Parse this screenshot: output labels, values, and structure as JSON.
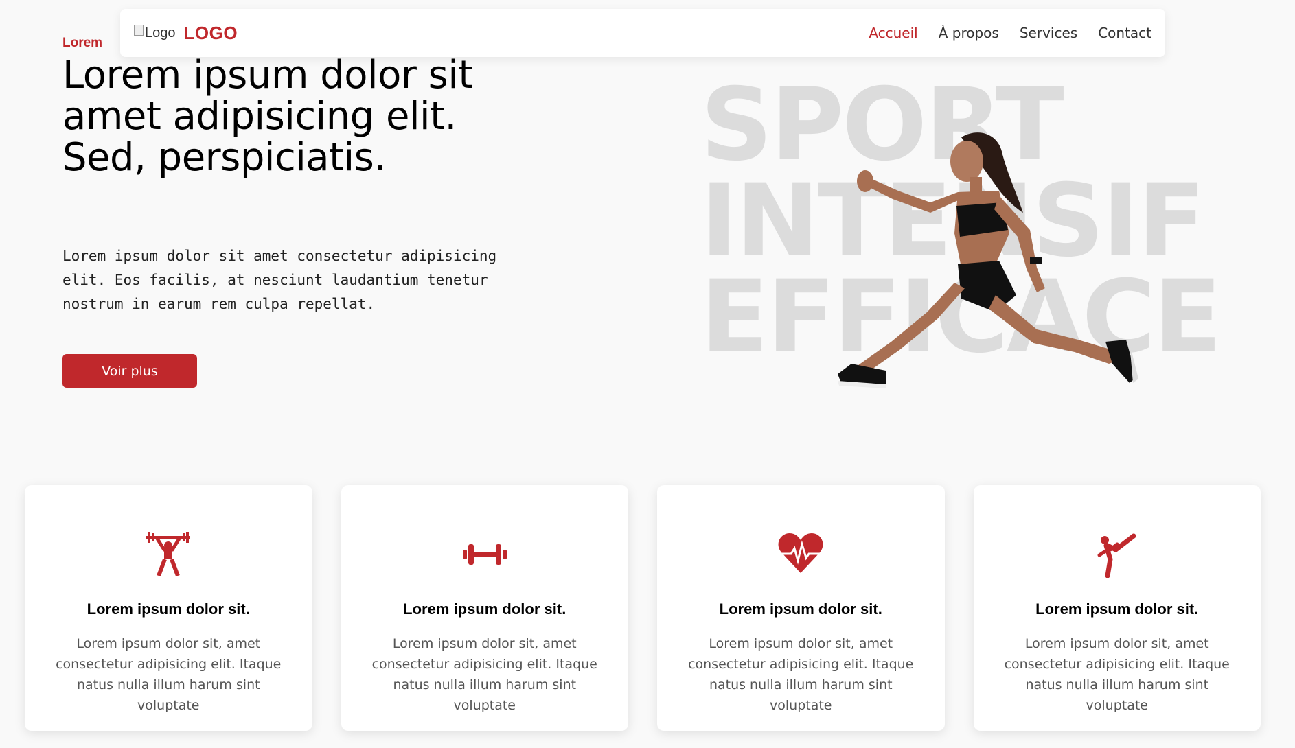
{
  "nav": {
    "logo_alt": "Logo",
    "brand": "LOGO",
    "links": [
      {
        "label": "Accueil",
        "active": true
      },
      {
        "label": "À propos",
        "active": false
      },
      {
        "label": "Services",
        "active": false
      },
      {
        "label": "Contact",
        "active": false
      }
    ]
  },
  "hero": {
    "eyebrow": "Lorem",
    "title": "Lorem ipsum dolor sit amet adipisicing elit. Sed, perspiciatis.",
    "description": "Lorem ipsum dolor sit amet consectetur adipisicing elit. Eos facilis, at nesciunt laudantium tenetur nostrum in earum rem culpa repellat.",
    "cta_label": "Voir plus",
    "bg_words": [
      "SPORT",
      "INTENSIF",
      "EFFICACE"
    ]
  },
  "cards": [
    {
      "icon": "weightlifter-icon",
      "title": "Lorem ipsum dolor sit.",
      "text": "Lorem ipsum dolor sit, amet consectetur adipisicing elit. Itaque natus nulla illum harum sint voluptate"
    },
    {
      "icon": "dumbbell-icon",
      "title": "Lorem ipsum dolor sit.",
      "text": "Lorem ipsum dolor sit, amet consectetur adipisicing elit. Itaque natus nulla illum harum sint voluptate"
    },
    {
      "icon": "heartbeat-icon",
      "title": "Lorem ipsum dolor sit.",
      "text": "Lorem ipsum dolor sit, amet consectetur adipisicing elit. Itaque natus nulla illum harum sint voluptate"
    },
    {
      "icon": "martial-arts-icon",
      "title": "Lorem ipsum dolor sit.",
      "text": "Lorem ipsum dolor sit, amet consectetur adipisicing elit. Itaque natus nulla illum harum sint voluptate"
    }
  ],
  "colors": {
    "accent": "#c0282c",
    "background": "#f9f9f9",
    "bg_words": "#dcdcdc"
  }
}
